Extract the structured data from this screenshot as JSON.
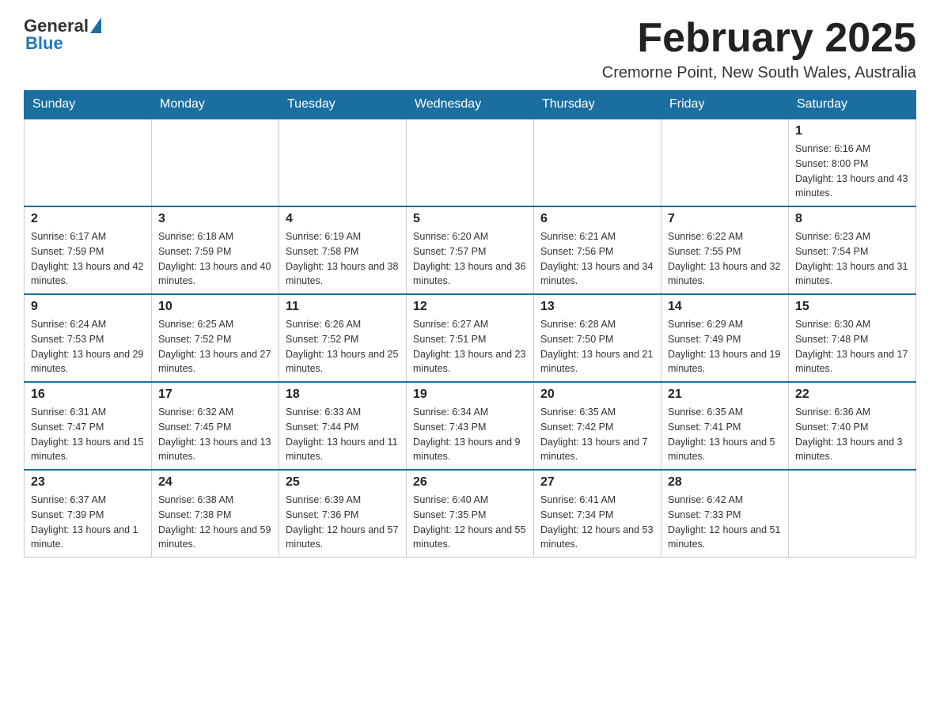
{
  "logo": {
    "general": "General",
    "blue": "Blue"
  },
  "header": {
    "month_title": "February 2025",
    "location": "Cremorne Point, New South Wales, Australia"
  },
  "weekdays": [
    "Sunday",
    "Monday",
    "Tuesday",
    "Wednesday",
    "Thursday",
    "Friday",
    "Saturday"
  ],
  "weeks": [
    {
      "days": [
        {
          "num": "",
          "info": ""
        },
        {
          "num": "",
          "info": ""
        },
        {
          "num": "",
          "info": ""
        },
        {
          "num": "",
          "info": ""
        },
        {
          "num": "",
          "info": ""
        },
        {
          "num": "",
          "info": ""
        },
        {
          "num": "1",
          "info": "Sunrise: 6:16 AM\nSunset: 8:00 PM\nDaylight: 13 hours and 43 minutes."
        }
      ]
    },
    {
      "days": [
        {
          "num": "2",
          "info": "Sunrise: 6:17 AM\nSunset: 7:59 PM\nDaylight: 13 hours and 42 minutes."
        },
        {
          "num": "3",
          "info": "Sunrise: 6:18 AM\nSunset: 7:59 PM\nDaylight: 13 hours and 40 minutes."
        },
        {
          "num": "4",
          "info": "Sunrise: 6:19 AM\nSunset: 7:58 PM\nDaylight: 13 hours and 38 minutes."
        },
        {
          "num": "5",
          "info": "Sunrise: 6:20 AM\nSunset: 7:57 PM\nDaylight: 13 hours and 36 minutes."
        },
        {
          "num": "6",
          "info": "Sunrise: 6:21 AM\nSunset: 7:56 PM\nDaylight: 13 hours and 34 minutes."
        },
        {
          "num": "7",
          "info": "Sunrise: 6:22 AM\nSunset: 7:55 PM\nDaylight: 13 hours and 32 minutes."
        },
        {
          "num": "8",
          "info": "Sunrise: 6:23 AM\nSunset: 7:54 PM\nDaylight: 13 hours and 31 minutes."
        }
      ]
    },
    {
      "days": [
        {
          "num": "9",
          "info": "Sunrise: 6:24 AM\nSunset: 7:53 PM\nDaylight: 13 hours and 29 minutes."
        },
        {
          "num": "10",
          "info": "Sunrise: 6:25 AM\nSunset: 7:52 PM\nDaylight: 13 hours and 27 minutes."
        },
        {
          "num": "11",
          "info": "Sunrise: 6:26 AM\nSunset: 7:52 PM\nDaylight: 13 hours and 25 minutes."
        },
        {
          "num": "12",
          "info": "Sunrise: 6:27 AM\nSunset: 7:51 PM\nDaylight: 13 hours and 23 minutes."
        },
        {
          "num": "13",
          "info": "Sunrise: 6:28 AM\nSunset: 7:50 PM\nDaylight: 13 hours and 21 minutes."
        },
        {
          "num": "14",
          "info": "Sunrise: 6:29 AM\nSunset: 7:49 PM\nDaylight: 13 hours and 19 minutes."
        },
        {
          "num": "15",
          "info": "Sunrise: 6:30 AM\nSunset: 7:48 PM\nDaylight: 13 hours and 17 minutes."
        }
      ]
    },
    {
      "days": [
        {
          "num": "16",
          "info": "Sunrise: 6:31 AM\nSunset: 7:47 PM\nDaylight: 13 hours and 15 minutes."
        },
        {
          "num": "17",
          "info": "Sunrise: 6:32 AM\nSunset: 7:45 PM\nDaylight: 13 hours and 13 minutes."
        },
        {
          "num": "18",
          "info": "Sunrise: 6:33 AM\nSunset: 7:44 PM\nDaylight: 13 hours and 11 minutes."
        },
        {
          "num": "19",
          "info": "Sunrise: 6:34 AM\nSunset: 7:43 PM\nDaylight: 13 hours and 9 minutes."
        },
        {
          "num": "20",
          "info": "Sunrise: 6:35 AM\nSunset: 7:42 PM\nDaylight: 13 hours and 7 minutes."
        },
        {
          "num": "21",
          "info": "Sunrise: 6:35 AM\nSunset: 7:41 PM\nDaylight: 13 hours and 5 minutes."
        },
        {
          "num": "22",
          "info": "Sunrise: 6:36 AM\nSunset: 7:40 PM\nDaylight: 13 hours and 3 minutes."
        }
      ]
    },
    {
      "days": [
        {
          "num": "23",
          "info": "Sunrise: 6:37 AM\nSunset: 7:39 PM\nDaylight: 13 hours and 1 minute."
        },
        {
          "num": "24",
          "info": "Sunrise: 6:38 AM\nSunset: 7:38 PM\nDaylight: 12 hours and 59 minutes."
        },
        {
          "num": "25",
          "info": "Sunrise: 6:39 AM\nSunset: 7:36 PM\nDaylight: 12 hours and 57 minutes."
        },
        {
          "num": "26",
          "info": "Sunrise: 6:40 AM\nSunset: 7:35 PM\nDaylight: 12 hours and 55 minutes."
        },
        {
          "num": "27",
          "info": "Sunrise: 6:41 AM\nSunset: 7:34 PM\nDaylight: 12 hours and 53 minutes."
        },
        {
          "num": "28",
          "info": "Sunrise: 6:42 AM\nSunset: 7:33 PM\nDaylight: 12 hours and 51 minutes."
        },
        {
          "num": "",
          "info": ""
        }
      ]
    }
  ]
}
